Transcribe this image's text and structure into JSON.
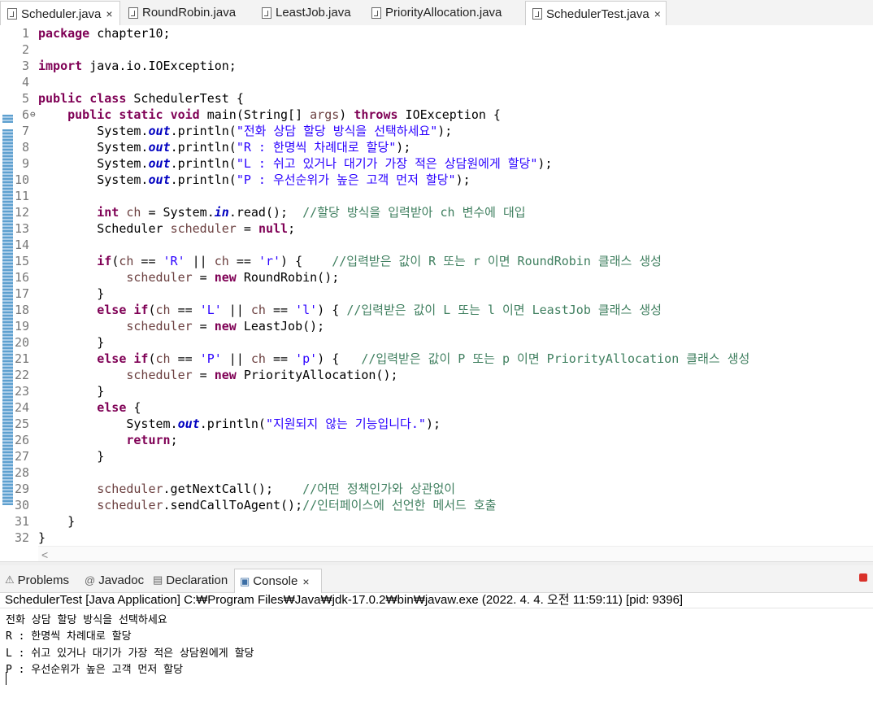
{
  "editor_tabs": [
    {
      "label": "Scheduler.java",
      "close": "×",
      "active": true
    },
    {
      "label": "RoundRobin.java",
      "close": "",
      "active": false
    },
    {
      "label": "LeastJob.java",
      "close": "",
      "active": false
    },
    {
      "label": "PriorityAllocation.java",
      "close": "",
      "active": false
    },
    {
      "label": "SchedulerTest.java",
      "close": "×",
      "active": true
    }
  ],
  "code_lines": [
    [
      {
        "c": "kw",
        "t": "package"
      },
      {
        "c": "",
        "t": " chapter10;"
      }
    ],
    [],
    [
      {
        "c": "kw",
        "t": "import"
      },
      {
        "c": "",
        "t": " java.io.IOException;"
      }
    ],
    [],
    [
      {
        "c": "kw",
        "t": "public"
      },
      {
        "c": "",
        "t": " "
      },
      {
        "c": "kw",
        "t": "class"
      },
      {
        "c": "",
        "t": " SchedulerTest {"
      }
    ],
    [
      {
        "c": "",
        "t": "    "
      },
      {
        "c": "kw",
        "t": "public"
      },
      {
        "c": "",
        "t": " "
      },
      {
        "c": "kw",
        "t": "static"
      },
      {
        "c": "",
        "t": " "
      },
      {
        "c": "kw",
        "t": "void"
      },
      {
        "c": "",
        "t": " main(String[] "
      },
      {
        "c": "loc",
        "t": "args"
      },
      {
        "c": "",
        "t": ") "
      },
      {
        "c": "kw",
        "t": "throws"
      },
      {
        "c": "",
        "t": " IOException {"
      }
    ],
    [
      {
        "c": "",
        "t": "        System."
      },
      {
        "c": "fld",
        "t": "out"
      },
      {
        "c": "",
        "t": ".println("
      },
      {
        "c": "str",
        "t": "\"전화 상담 할당 방식을 선택하세요\""
      },
      {
        "c": "",
        "t": ");"
      }
    ],
    [
      {
        "c": "",
        "t": "        System."
      },
      {
        "c": "fld",
        "t": "out"
      },
      {
        "c": "",
        "t": ".println("
      },
      {
        "c": "str",
        "t": "\"R : 한명씩 차례대로 할당\""
      },
      {
        "c": "",
        "t": ");"
      }
    ],
    [
      {
        "c": "",
        "t": "        System."
      },
      {
        "c": "fld",
        "t": "out"
      },
      {
        "c": "",
        "t": ".println("
      },
      {
        "c": "str",
        "t": "\"L : 쉬고 있거나 대기가 가장 적은 상담원에게 할당\""
      },
      {
        "c": "",
        "t": ");"
      }
    ],
    [
      {
        "c": "",
        "t": "        System."
      },
      {
        "c": "fld",
        "t": "out"
      },
      {
        "c": "",
        "t": ".println("
      },
      {
        "c": "str",
        "t": "\"P : 우선순위가 높은 고객 먼저 할당\""
      },
      {
        "c": "",
        "t": ");"
      }
    ],
    [],
    [
      {
        "c": "",
        "t": "        "
      },
      {
        "c": "kw",
        "t": "int"
      },
      {
        "c": "",
        "t": " "
      },
      {
        "c": "loc",
        "t": "ch"
      },
      {
        "c": "",
        "t": " = System."
      },
      {
        "c": "fld",
        "t": "in"
      },
      {
        "c": "",
        "t": ".read();  "
      },
      {
        "c": "cm",
        "t": "//할당 방식을 입력받아 ch 변수에 대입"
      }
    ],
    [
      {
        "c": "",
        "t": "        Scheduler "
      },
      {
        "c": "loc",
        "t": "scheduler"
      },
      {
        "c": "",
        "t": " = "
      },
      {
        "c": "kw",
        "t": "null"
      },
      {
        "c": "",
        "t": ";"
      }
    ],
    [],
    [
      {
        "c": "",
        "t": "        "
      },
      {
        "c": "kw",
        "t": "if"
      },
      {
        "c": "",
        "t": "("
      },
      {
        "c": "loc",
        "t": "ch"
      },
      {
        "c": "",
        "t": " == "
      },
      {
        "c": "str",
        "t": "'R'"
      },
      {
        "c": "",
        "t": " || "
      },
      {
        "c": "loc",
        "t": "ch"
      },
      {
        "c": "",
        "t": " == "
      },
      {
        "c": "str",
        "t": "'r'"
      },
      {
        "c": "",
        "t": ") {    "
      },
      {
        "c": "cm",
        "t": "//입력받은 값이 R 또는 r 이면 RoundRobin 클래스 생성"
      }
    ],
    [
      {
        "c": "",
        "t": "            "
      },
      {
        "c": "loc",
        "t": "scheduler"
      },
      {
        "c": "",
        "t": " = "
      },
      {
        "c": "kw",
        "t": "new"
      },
      {
        "c": "",
        "t": " RoundRobin();"
      }
    ],
    [
      {
        "c": "",
        "t": "        }"
      }
    ],
    [
      {
        "c": "",
        "t": "        "
      },
      {
        "c": "kw",
        "t": "else"
      },
      {
        "c": "",
        "t": " "
      },
      {
        "c": "kw",
        "t": "if"
      },
      {
        "c": "",
        "t": "("
      },
      {
        "c": "loc",
        "t": "ch"
      },
      {
        "c": "",
        "t": " == "
      },
      {
        "c": "str",
        "t": "'L'"
      },
      {
        "c": "",
        "t": " || "
      },
      {
        "c": "loc",
        "t": "ch"
      },
      {
        "c": "",
        "t": " == "
      },
      {
        "c": "str",
        "t": "'l'"
      },
      {
        "c": "",
        "t": ") { "
      },
      {
        "c": "cm",
        "t": "//입력받은 값이 L 또는 l 이면 LeastJob 클래스 생성"
      }
    ],
    [
      {
        "c": "",
        "t": "            "
      },
      {
        "c": "loc",
        "t": "scheduler"
      },
      {
        "c": "",
        "t": " = "
      },
      {
        "c": "kw",
        "t": "new"
      },
      {
        "c": "",
        "t": " LeastJob();"
      }
    ],
    [
      {
        "c": "",
        "t": "        }"
      }
    ],
    [
      {
        "c": "",
        "t": "        "
      },
      {
        "c": "kw",
        "t": "else"
      },
      {
        "c": "",
        "t": " "
      },
      {
        "c": "kw",
        "t": "if"
      },
      {
        "c": "",
        "t": "("
      },
      {
        "c": "loc",
        "t": "ch"
      },
      {
        "c": "",
        "t": " == "
      },
      {
        "c": "str",
        "t": "'P'"
      },
      {
        "c": "",
        "t": " || "
      },
      {
        "c": "loc",
        "t": "ch"
      },
      {
        "c": "",
        "t": " == "
      },
      {
        "c": "str",
        "t": "'p'"
      },
      {
        "c": "",
        "t": ") {   "
      },
      {
        "c": "cm",
        "t": "//입력받은 값이 P 또는 p 이면 PriorityAllocation 클래스 생성"
      }
    ],
    [
      {
        "c": "",
        "t": "            "
      },
      {
        "c": "loc",
        "t": "scheduler"
      },
      {
        "c": "",
        "t": " = "
      },
      {
        "c": "kw",
        "t": "new"
      },
      {
        "c": "",
        "t": " PriorityAllocation();"
      }
    ],
    [
      {
        "c": "",
        "t": "        }"
      }
    ],
    [
      {
        "c": "",
        "t": "        "
      },
      {
        "c": "kw",
        "t": "else"
      },
      {
        "c": "",
        "t": " {"
      }
    ],
    [
      {
        "c": "",
        "t": "            System."
      },
      {
        "c": "fld",
        "t": "out"
      },
      {
        "c": "",
        "t": ".println("
      },
      {
        "c": "str",
        "t": "\"지원되지 않는 기능입니다.\""
      },
      {
        "c": "",
        "t": ");"
      }
    ],
    [
      {
        "c": "",
        "t": "            "
      },
      {
        "c": "kw",
        "t": "return"
      },
      {
        "c": "",
        "t": ";"
      }
    ],
    [
      {
        "c": "",
        "t": "        }"
      }
    ],
    [],
    [
      {
        "c": "",
        "t": "        "
      },
      {
        "c": "loc",
        "t": "scheduler"
      },
      {
        "c": "",
        "t": ".getNextCall();    "
      },
      {
        "c": "cm",
        "t": "//어떤 정책인가와 상관없이"
      }
    ],
    [
      {
        "c": "",
        "t": "        "
      },
      {
        "c": "loc",
        "t": "scheduler"
      },
      {
        "c": "",
        "t": ".sendCallToAgent();"
      },
      {
        "c": "cm",
        "t": "//인터페이스에 선언한 메서드 호출"
      }
    ],
    [
      {
        "c": "",
        "t": "    }"
      }
    ],
    [
      {
        "c": "",
        "t": "}"
      }
    ]
  ],
  "fold_marker": "⊖",
  "hscroll_arrow": "<",
  "view_tabs": [
    {
      "icon": "⚠",
      "icon_name": "problems-icon",
      "label": "Problems"
    },
    {
      "icon": "@",
      "icon_name": "javadoc-icon",
      "label": "Javadoc"
    },
    {
      "icon": "▤",
      "icon_name": "declaration-icon",
      "label": "Declaration"
    },
    {
      "icon": "▣",
      "icon_name": "console-icon",
      "label": "Console",
      "close": "×"
    }
  ],
  "console": {
    "launch_info": "SchedulerTest [Java Application] C:₩Program Files₩Java₩jdk-17.0.2₩bin₩javaw.exe  (2022. 4. 4. 오전 11:59:11) [pid: 9396]",
    "output": [
      "전화 상담 할당 방식을 선택하세요",
      "R : 한명씩 차례대로 할당",
      "L : 쉬고 있거나 대기가 가장 적은 상담원에게 할당",
      "P : 우선순위가 높은 고객 먼저 할당"
    ]
  }
}
